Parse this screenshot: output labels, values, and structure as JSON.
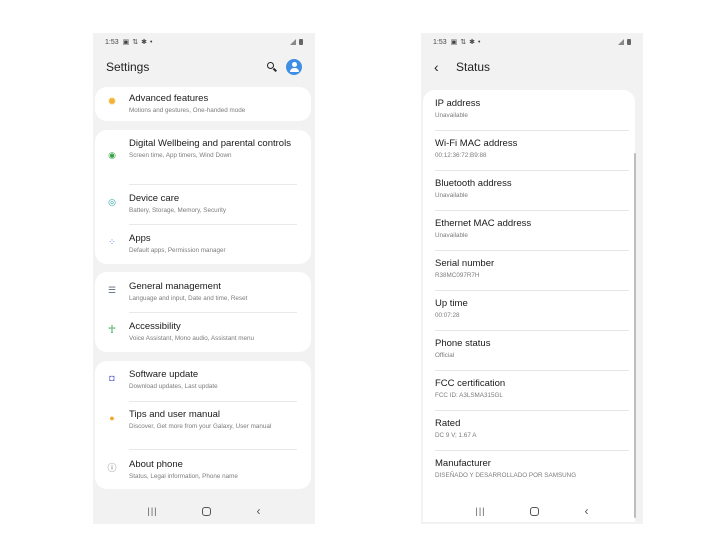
{
  "left": {
    "status_bar": {
      "time": "1:53"
    },
    "header": {
      "title": "Settings"
    },
    "groups": [
      {
        "items": [
          {
            "title": "Advanced features",
            "subtitle": "Motions and gestures, One-handed mode",
            "icon": "gear-icon",
            "color": "#f2b134"
          }
        ]
      },
      {
        "items": [
          {
            "title": "Digital Wellbeing and parental controls",
            "subtitle": "Screen time, App timers, Wind Down",
            "icon": "wellbeing-icon",
            "color": "#3aa64c"
          },
          {
            "title": "Device care",
            "subtitle": "Battery, Storage, Memory, Security",
            "icon": "device-care-icon",
            "color": "#1f9fa3"
          },
          {
            "title": "Apps",
            "subtitle": "Default apps, Permission manager",
            "icon": "apps-icon",
            "color": "#4a7ed8"
          }
        ]
      },
      {
        "items": [
          {
            "title": "General management",
            "subtitle": "Language and input, Date and time, Reset",
            "icon": "sliders-icon",
            "color": "#5a6b7d"
          },
          {
            "title": "Accessibility",
            "subtitle": "Voice Assistant, Mono audio, Assistant menu",
            "icon": "accessibility-icon",
            "color": "#31a34a"
          }
        ]
      },
      {
        "items": [
          {
            "title": "Software update",
            "subtitle": "Download updates, Last update",
            "icon": "software-update-icon",
            "color": "#6c6fd1"
          },
          {
            "title": "Tips and user manual",
            "subtitle": "Discover, Get more from your Galaxy, User manual",
            "icon": "lightbulb-icon",
            "color": "#f0a830"
          },
          {
            "title": "About phone",
            "subtitle": "Status, Legal information, Phone name",
            "icon": "info-icon",
            "color": "#6e6e6e"
          }
        ]
      }
    ]
  },
  "right": {
    "status_bar": {
      "time": "1:53"
    },
    "header": {
      "title": "Status"
    },
    "items": [
      {
        "title": "IP address",
        "value": "Unavailable"
      },
      {
        "title": "Wi-Fi MAC address",
        "value": "00:12:36:72:B9:88"
      },
      {
        "title": "Bluetooth address",
        "value": "Unavailable"
      },
      {
        "title": "Ethernet MAC address",
        "value": "Unavailable"
      },
      {
        "title": "Serial number",
        "value": "R38MC097R7H"
      },
      {
        "title": "Up time",
        "value": "00:07:28"
      },
      {
        "title": "Phone status",
        "value": "Official"
      },
      {
        "title": "FCC certification",
        "value": "FCC ID: A3LSMA315GL"
      },
      {
        "title": "Rated",
        "value": "DC 9 V; 1.67 A"
      },
      {
        "title": "Manufacturer",
        "value": "DISEÑADO Y DESARROLLADO POR SAMSUNG"
      }
    ]
  }
}
